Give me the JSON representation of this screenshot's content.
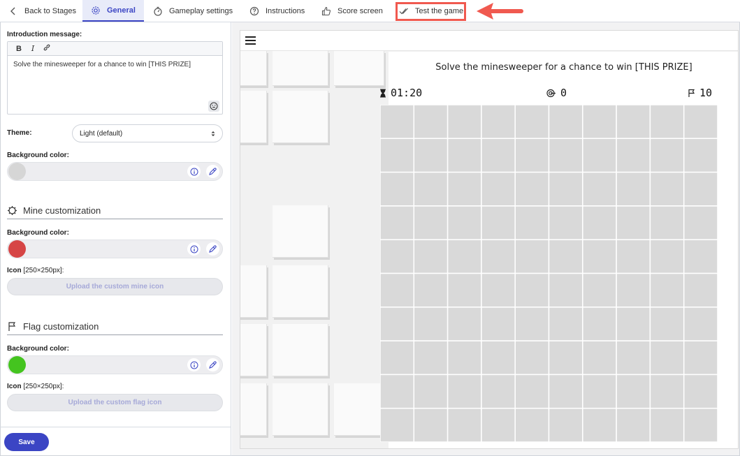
{
  "tabs": [
    {
      "label": "Back to Stages",
      "icon": "chevron-left-icon"
    },
    {
      "label": "General",
      "icon": "gear-icon",
      "active": true
    },
    {
      "label": "Gameplay settings",
      "icon": "timer-icon"
    },
    {
      "label": "Instructions",
      "icon": "question-icon"
    },
    {
      "label": "Score screen",
      "icon": "thumbs-up-icon"
    },
    {
      "label": "Test the game",
      "icon": "double-check-icon",
      "highlighted": true
    }
  ],
  "general": {
    "intro_label": "Introduction message:",
    "toolbar": {
      "bold": "B",
      "italic": "I"
    },
    "intro_text": "Solve the minesweeper for a chance to win [THIS PRIZE]",
    "theme_label": "Theme:",
    "theme_value": "Light (default)",
    "bg_color_label": "Background color:",
    "bg_color": "#d6d6d6"
  },
  "mine": {
    "title": "Mine customization",
    "bg_color_label": "Background color:",
    "color": "#d64545",
    "icon_label": "Icon",
    "icon_size": "[250×250px]:",
    "upload_label": "Upload the custom mine icon"
  },
  "flag": {
    "title": "Flag customization",
    "bg_color_label": "Background color:",
    "color": "#44c41f",
    "icon_label": "Icon",
    "icon_size": "[250×250px]:",
    "upload_label": "Upload the custom flag icon"
  },
  "save_label": "Save",
  "preview": {
    "intro": "Solve the minesweeper for a chance to win [THIS PRIZE]",
    "timer": "01:20",
    "mines_found": "0",
    "flags": "10",
    "grid_size": 10
  },
  "colors": {
    "accent": "#3b45c4",
    "highlight": "#f0594f"
  }
}
